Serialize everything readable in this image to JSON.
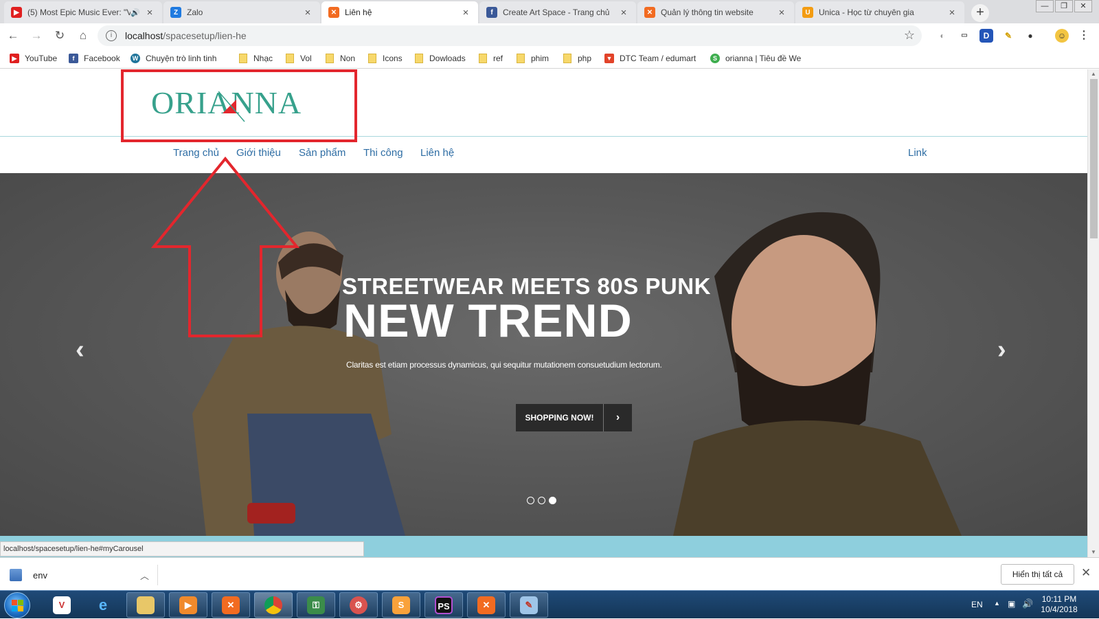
{
  "tabs": [
    {
      "title": "(5) Most Epic Music Ever: \"V",
      "favicon": "youtube-icon",
      "color": "#e02020"
    },
    {
      "title": "Zalo",
      "favicon": "zalo-icon",
      "color": "#1f7ae0"
    },
    {
      "title": "Liên hệ",
      "favicon": "xampp-icon",
      "color": "#f26b21"
    },
    {
      "title": "Create Art Space - Trang chủ",
      "favicon": "facebook-icon",
      "color": "#3b5998"
    },
    {
      "title": "Quản lý thông tin website",
      "favicon": "xampp-icon",
      "color": "#f26b21"
    },
    {
      "title": "Unica - Học từ chuyên gia",
      "favicon": "unica-icon",
      "color": "#f39c12"
    }
  ],
  "address": {
    "host": "localhost",
    "path": "/spacesetup/lien-he"
  },
  "bookmarks": [
    {
      "label": "YouTube",
      "icon": "youtube-icon"
    },
    {
      "label": "Facebook",
      "icon": "facebook-icon"
    },
    {
      "label": "Chuyện trò linh tinh",
      "icon": "wordpress-icon"
    },
    {
      "label": "Nhạc",
      "icon": "folder-icon"
    },
    {
      "label": "Vol",
      "icon": "folder-icon"
    },
    {
      "label": "Non",
      "icon": "folder-icon"
    },
    {
      "label": "Icons",
      "icon": "folder-icon"
    },
    {
      "label": "Dowloads",
      "icon": "folder-icon"
    },
    {
      "label": "ref",
      "icon": "folder-icon"
    },
    {
      "label": "phim",
      "icon": "folder-icon"
    },
    {
      "label": "php",
      "icon": "folder-icon"
    },
    {
      "label": "DTC Team / edumart",
      "icon": "gitlab-icon"
    },
    {
      "label": "orianna | Tiêu đề We",
      "icon": "orianna-icon"
    }
  ],
  "site": {
    "logo_text": "ORIANNA",
    "nav": [
      "Trang chủ",
      "Giới thiệu",
      "Sản phẩm",
      "Thi công",
      "Liên hệ"
    ],
    "nav_right": "Link"
  },
  "hero": {
    "subtitle": "STREETWEAR MEETS 80S PUNK",
    "title": "NEW TREND",
    "description": "Claritas est etiam processus dynamicus, qui sequitur mutationem consuetudium lectorum.",
    "button_label": "SHOPPING NOW!",
    "slide_count": 3,
    "active_slide": 3
  },
  "status_url": "localhost/spacesetup/lien-he#myCarousel",
  "download": {
    "filename": "env",
    "show_all": "Hiển thị tất cả"
  },
  "tray": {
    "language": "EN",
    "time": "10:11 PM",
    "date": "10/4/2018"
  },
  "colors": {
    "brand": "#37a18c",
    "nav_link": "#2e6da4",
    "annotation": "#e3262d",
    "band": "#8ecfdd"
  }
}
